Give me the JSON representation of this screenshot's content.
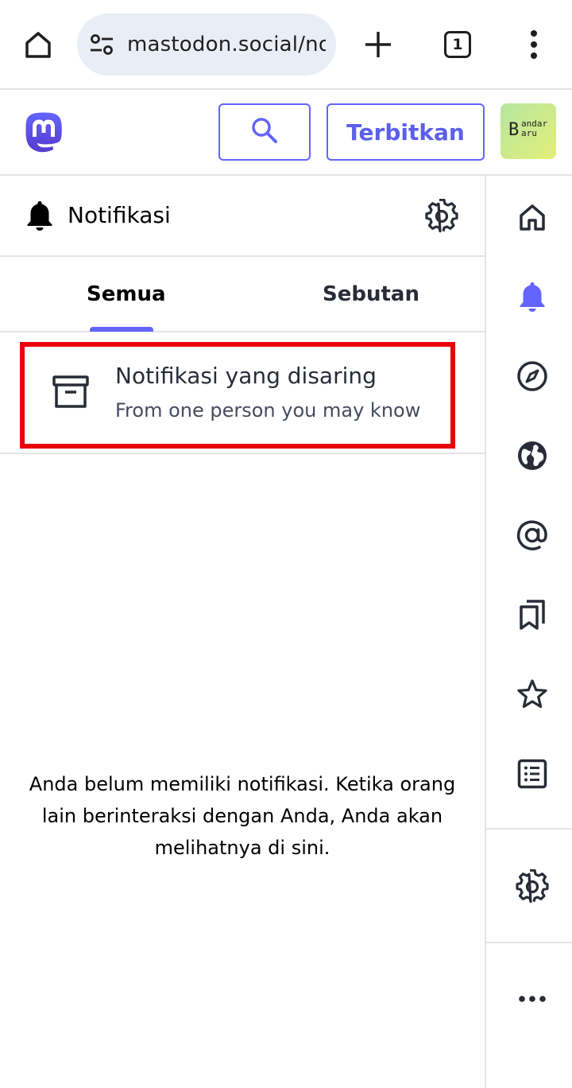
{
  "browser": {
    "url": "mastodon.social/no",
    "tab_count": "1"
  },
  "header": {
    "publish_label": "Terbitkan",
    "avatar": {
      "letter": "B",
      "line1": "andar",
      "line2": "aru"
    }
  },
  "column": {
    "title": "Notifikasi",
    "tabs": [
      {
        "label": "Semua",
        "active": true
      },
      {
        "label": "Sebutan",
        "active": false
      }
    ]
  },
  "filtered": {
    "title": "Notifikasi yang disaring",
    "subtitle": "From one person you may know"
  },
  "empty_message": "Anda belum memiliki notifikasi. Ketika orang lain berinteraksi dengan Anda, Anda akan melihatnya di sini.",
  "nav_rail": {
    "items": [
      "home-icon",
      "bell-icon",
      "compass-icon",
      "globe-icon",
      "at-icon",
      "bookmarks-icon",
      "star-icon",
      "list-icon",
      "gear-icon",
      "more-icon"
    ],
    "active": "bell-icon"
  },
  "colors": {
    "accent": "#6364ff",
    "highlight_border": "#e8000b",
    "divider": "#e4e4e8"
  }
}
